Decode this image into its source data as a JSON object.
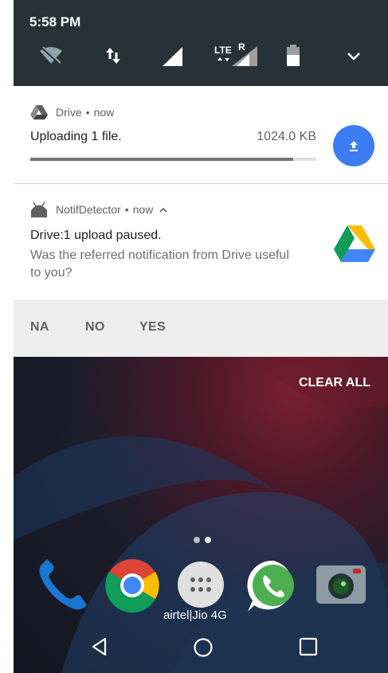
{
  "status_bar": {
    "time": "5:58 PM",
    "icons": [
      "wifi-off-icon",
      "data-transfer-icon",
      "cell-signal-icon",
      "lte-roaming-signal-icon",
      "battery-icon",
      "expand-chevron-icon"
    ],
    "lte_label": "LTE",
    "roaming_label": "R"
  },
  "notification_drive": {
    "app_name": "Drive",
    "separator": "•",
    "time": "now",
    "title": "Uploading 1 file.",
    "size": "1024.0 KB",
    "progress": 0.92,
    "icon": "drive-icon",
    "action_icon": "upload-icon"
  },
  "notification_detector": {
    "app_name": "NotifDetector",
    "separator": "•",
    "time": "now",
    "expand_icon": "chevron-up-icon",
    "title": "Drive:1 upload paused.",
    "body": "Was the referred notification from Drive useful to you?",
    "icon": "google-drive-logo-icon",
    "actions": [
      "NA",
      "NO",
      "YES"
    ]
  },
  "home": {
    "clear_all": "CLEAR ALL",
    "dock_apps": [
      "phone-icon",
      "chrome-icon",
      "app-drawer-icon",
      "whatsapp-icon",
      "camera-icon"
    ],
    "carrier_label": "airtel|Jio 4G"
  },
  "nav_bar": {
    "buttons": [
      "back-icon",
      "home-icon",
      "recents-icon"
    ]
  },
  "colors": {
    "qs_background": "#263238",
    "upload_button": "#3d7cf2",
    "action_bar": "#eeeeee"
  }
}
